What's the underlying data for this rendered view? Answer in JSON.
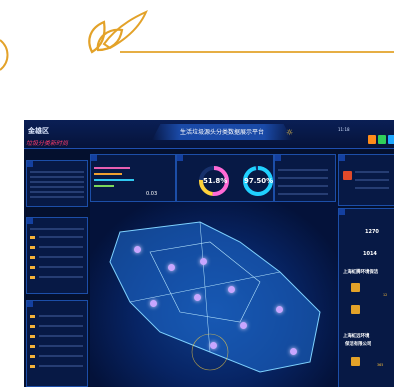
{
  "header": {
    "location": "金雄区",
    "description": "",
    "slogan": "垃圾分类新时尚",
    "title": "生活垃圾源头分类数据展示平台",
    "weather_icon": "sun-icon",
    "time": "11:18",
    "date": ""
  },
  "gauges": [
    {
      "value": "51.8%",
      "color": "#ff6ad5"
    },
    {
      "value": "97.50%",
      "color": "#20d1ff"
    }
  ],
  "left_values": {
    "small_value": "0.03"
  },
  "right_stats": [
    {
      "value": "1270"
    },
    {
      "value": "1014"
    }
  ],
  "companies": [
    {
      "name": "上海虹腾环境保洁",
      "sub": "",
      "value": "12"
    },
    {
      "name": "上海虹远环境",
      "sub": "保洁有限公司",
      "value": "365"
    }
  ],
  "colors": {
    "background": "#04102e",
    "panel_border": "#1c4ea8",
    "accent_orange": "#ffc23a",
    "deco_gold": "#e3a229"
  }
}
